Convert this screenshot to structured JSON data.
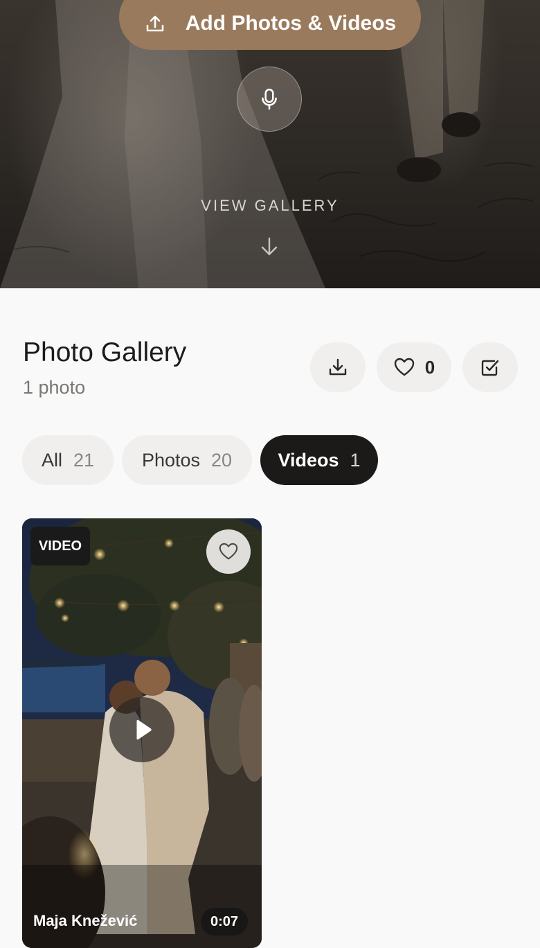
{
  "hero": {
    "upload_label": "Add Photos & Videos",
    "view_gallery_label": "VIEW GALLERY",
    "icons": {
      "upload": "upload-icon",
      "mic": "microphone-icon",
      "arrow": "arrow-down-icon"
    }
  },
  "gallery": {
    "title": "Photo Gallery",
    "subtitle": "1 photo",
    "favorites_count": "0",
    "actions": {
      "download": "download-icon",
      "favorites": "heart-icon",
      "select": "checkbox-icon"
    }
  },
  "filters": [
    {
      "label": "All",
      "count": "21",
      "active": false
    },
    {
      "label": "Photos",
      "count": "20",
      "active": false
    },
    {
      "label": "Videos",
      "count": "1",
      "active": true
    }
  ],
  "media": [
    {
      "type_badge": "VIDEO",
      "author": "Maja Knežević",
      "duration": "0:07",
      "liked": false
    }
  ],
  "colors": {
    "accent": "#9a7a5c",
    "active_tab": "#1c1a19",
    "background": "#f9f9f9"
  }
}
